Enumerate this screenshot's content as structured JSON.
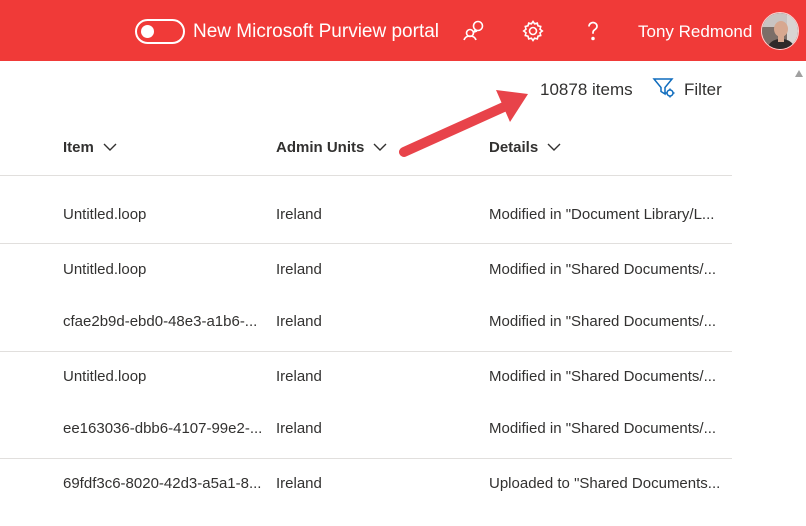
{
  "header": {
    "toggle_label": "New Microsoft Purview portal",
    "toggle_on": false,
    "user_name": "Tony Redmond",
    "icons": [
      "community-icon",
      "gear-icon",
      "help-icon"
    ],
    "bar_color": "#f03a38"
  },
  "toolbar": {
    "item_count": "10878 items",
    "filter_label": "Filter"
  },
  "table": {
    "columns": [
      {
        "label": "Item"
      },
      {
        "label": "Admin Units"
      },
      {
        "label": "Details"
      }
    ],
    "rows": [
      {
        "item": "Untitled.loop",
        "admin_unit": "Ireland",
        "details": "Modified in \"Document Library/L..."
      },
      {
        "item": "Untitled.loop",
        "admin_unit": "Ireland",
        "details": "Modified in \"Shared Documents/..."
      },
      {
        "item": "cfae2b9d-ebd0-48e3-a1b6-...",
        "admin_unit": "Ireland",
        "details": "Modified in \"Shared Documents/..."
      },
      {
        "item": "Untitled.loop",
        "admin_unit": "Ireland",
        "details": "Modified in \"Shared Documents/..."
      },
      {
        "item": "ee163036-dbb6-4107-99e2-...",
        "admin_unit": "Ireland",
        "details": "Modified in \"Shared Documents/..."
      },
      {
        "item": "69fdf3c6-8020-42d3-a5a1-8...",
        "admin_unit": "Ireland",
        "details": "Uploaded to \"Shared Documents..."
      }
    ]
  },
  "annotation": {
    "arrow_color": "#e8434a"
  }
}
